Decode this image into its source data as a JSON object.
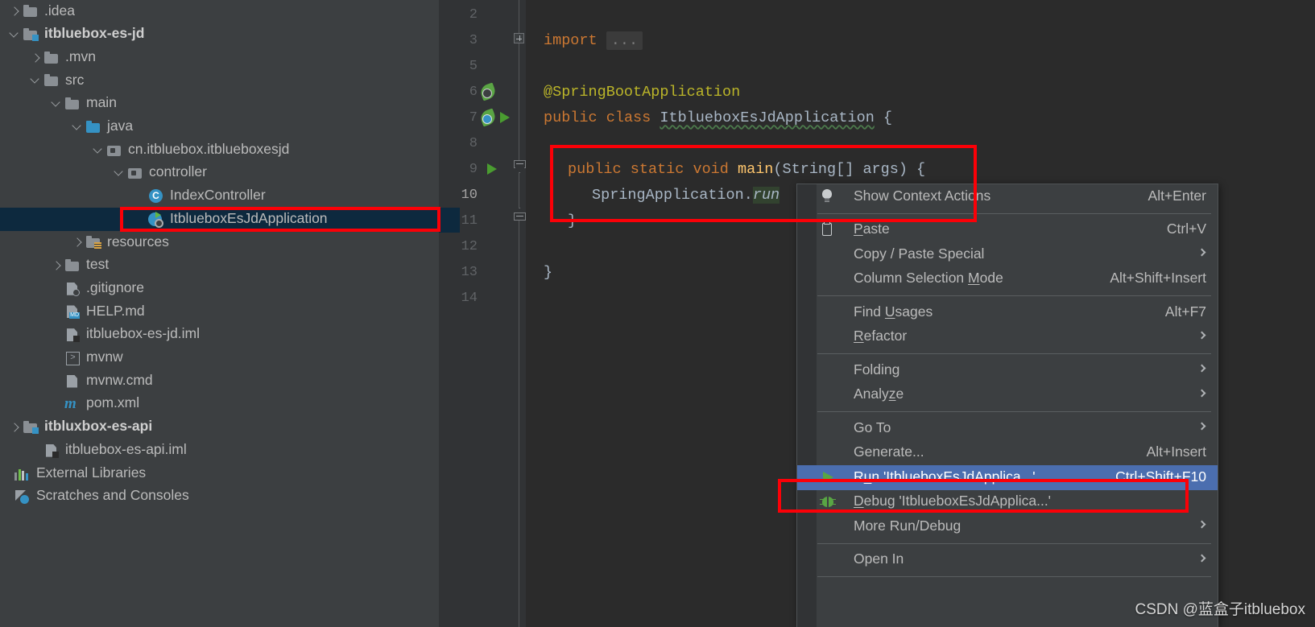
{
  "sidebar": {
    "items": [
      {
        "label": ".idea",
        "indent": 0,
        "twisty": "closed",
        "icon": "folder-icon",
        "bold": false,
        "selected": false
      },
      {
        "label": "itbluebox-es-jd",
        "indent": 0,
        "twisty": "open",
        "icon": "module-folder-icon",
        "bold": true,
        "selected": false
      },
      {
        "label": ".mvn",
        "indent": 1,
        "twisty": "closed",
        "icon": "folder-icon",
        "bold": false,
        "selected": false
      },
      {
        "label": "src",
        "indent": 1,
        "twisty": "open",
        "icon": "folder-icon",
        "bold": false,
        "selected": false
      },
      {
        "label": "main",
        "indent": 2,
        "twisty": "open",
        "icon": "folder-icon",
        "bold": false,
        "selected": false
      },
      {
        "label": "java",
        "indent": 3,
        "twisty": "open",
        "icon": "source-folder-icon",
        "bold": false,
        "selected": false
      },
      {
        "label": "cn.itbluebox.itblueboxesjd",
        "indent": 4,
        "twisty": "open",
        "icon": "package-icon",
        "bold": false,
        "selected": false
      },
      {
        "label": "controller",
        "indent": 5,
        "twisty": "open",
        "icon": "package-icon",
        "bold": false,
        "selected": false
      },
      {
        "label": "IndexController",
        "indent": 6,
        "twisty": "none",
        "icon": "java-class-icon",
        "bold": false,
        "selected": false
      },
      {
        "label": "ItblueboxEsJdApplication",
        "indent": 6,
        "twisty": "none",
        "icon": "spring-boot-app-icon",
        "bold": false,
        "selected": true
      },
      {
        "label": "resources",
        "indent": 3,
        "twisty": "closed",
        "icon": "resources-folder-icon",
        "bold": false,
        "selected": false
      },
      {
        "label": "test",
        "indent": 2,
        "twisty": "closed",
        "icon": "folder-icon",
        "bold": false,
        "selected": false
      },
      {
        "label": ".gitignore",
        "indent": 2,
        "twisty": "none",
        "icon": "gitignore-file-icon",
        "bold": false,
        "selected": false
      },
      {
        "label": "HELP.md",
        "indent": 2,
        "twisty": "none",
        "icon": "markdown-file-icon",
        "bold": false,
        "selected": false
      },
      {
        "label": "itbluebox-es-jd.iml",
        "indent": 2,
        "twisty": "none",
        "icon": "iml-file-icon",
        "bold": false,
        "selected": false
      },
      {
        "label": "mvnw",
        "indent": 2,
        "twisty": "none",
        "icon": "shell-script-icon",
        "bold": false,
        "selected": false
      },
      {
        "label": "mvnw.cmd",
        "indent": 2,
        "twisty": "none",
        "icon": "cmd-file-icon",
        "bold": false,
        "selected": false
      },
      {
        "label": "pom.xml",
        "indent": 2,
        "twisty": "none",
        "icon": "maven-file-icon",
        "bold": false,
        "selected": false
      },
      {
        "label": "itbluxbox-es-api",
        "indent": 0,
        "twisty": "closed",
        "icon": "module-folder-icon",
        "bold": true,
        "selected": false
      },
      {
        "label": "itbluebox-es-api.iml",
        "indent": 1,
        "twisty": "none",
        "icon": "iml-file-icon",
        "bold": false,
        "selected": false
      },
      {
        "label": "External Libraries",
        "indent": -1,
        "twisty": "none",
        "icon": "external-libraries-icon",
        "bold": false,
        "selected": false
      },
      {
        "label": "Scratches and Consoles",
        "indent": -1,
        "twisty": "none",
        "icon": "scratches-icon",
        "bold": false,
        "selected": false
      }
    ]
  },
  "editor": {
    "gutter_line_numbers": [
      "2",
      "3",
      "5",
      "6",
      "7",
      "8",
      "9",
      "10",
      "11",
      "12",
      "13",
      "14"
    ],
    "current_line_number": "10",
    "lines": {
      "import_keyword": "import",
      "folded_placeholder": "...",
      "annotation": "@SpringBootApplication",
      "class_public": "public",
      "class_keyword": "class",
      "class_name": "ItblueboxEsJdApplication",
      "class_open_brace": "{",
      "main_public": "public",
      "main_static": "static",
      "main_void": "void",
      "main_name": "main",
      "main_params": "(String[] args) {",
      "body_call_prefix": "SpringApplication.",
      "body_call_method": "run",
      "close_brace_inner": "}",
      "close_brace_outer": "}"
    }
  },
  "context_menu": {
    "items": [
      {
        "label": "Show Context Actions",
        "shortcut": "Alt+Enter",
        "icon": "lightbulb-icon",
        "submenu": false,
        "selected": false,
        "mnemonic": ""
      },
      {
        "type": "separator"
      },
      {
        "label": "Paste",
        "shortcut": "Ctrl+V",
        "icon": "paste-icon",
        "submenu": false,
        "selected": false,
        "mnemonic": "P"
      },
      {
        "label": "Copy / Paste Special",
        "shortcut": "",
        "icon": "",
        "submenu": true,
        "selected": false,
        "mnemonic": ""
      },
      {
        "label": "Column Selection Mode",
        "shortcut": "Alt+Shift+Insert",
        "icon": "",
        "submenu": false,
        "selected": false,
        "mnemonic": "M"
      },
      {
        "type": "separator"
      },
      {
        "label": "Find Usages",
        "shortcut": "Alt+F7",
        "icon": "",
        "submenu": false,
        "selected": false,
        "mnemonic": "U"
      },
      {
        "label": "Refactor",
        "shortcut": "",
        "icon": "",
        "submenu": true,
        "selected": false,
        "mnemonic": "R"
      },
      {
        "type": "separator"
      },
      {
        "label": "Folding",
        "shortcut": "",
        "icon": "",
        "submenu": true,
        "selected": false,
        "mnemonic": ""
      },
      {
        "label": "Analyze",
        "shortcut": "",
        "icon": "",
        "submenu": true,
        "selected": false,
        "mnemonic": "z"
      },
      {
        "type": "separator"
      },
      {
        "label": "Go To",
        "shortcut": "",
        "icon": "",
        "submenu": true,
        "selected": false,
        "mnemonic": ""
      },
      {
        "label": "Generate...",
        "shortcut": "Alt+Insert",
        "icon": "",
        "submenu": false,
        "selected": false,
        "mnemonic": ""
      },
      {
        "label": "Run 'ItblueboxEsJdApplica...'",
        "shortcut": "Ctrl+Shift+F10",
        "icon": "run-icon",
        "submenu": false,
        "selected": true,
        "mnemonic": "u"
      },
      {
        "label": "Debug 'ItblueboxEsJdApplica...'",
        "shortcut": "",
        "icon": "debug-icon",
        "submenu": false,
        "selected": false,
        "mnemonic": "D"
      },
      {
        "label": "More Run/Debug",
        "shortcut": "",
        "icon": "",
        "submenu": true,
        "selected": false,
        "mnemonic": ""
      },
      {
        "type": "separator"
      },
      {
        "label": "Open In",
        "shortcut": "",
        "icon": "",
        "submenu": true,
        "selected": false,
        "mnemonic": ""
      },
      {
        "type": "separator"
      }
    ]
  },
  "watermark": {
    "text": "CSDN @蓝盒子itbluebox"
  },
  "colors": {
    "sidebar_bg": "#3c3f41",
    "editor_bg": "#2b2b2b",
    "gutter_bg": "#313335",
    "tree_selection": "#0d293e",
    "menu_bg": "#3c3f41",
    "menu_selection": "#4b6eaf",
    "annotation_red": "#fb0007",
    "keyword_orange": "#cc7832",
    "annotation_yellow": "#bbb529",
    "method_yellow": "#ffc66d",
    "text_grey": "#a9b7c6",
    "run_green": "#59a544"
  }
}
